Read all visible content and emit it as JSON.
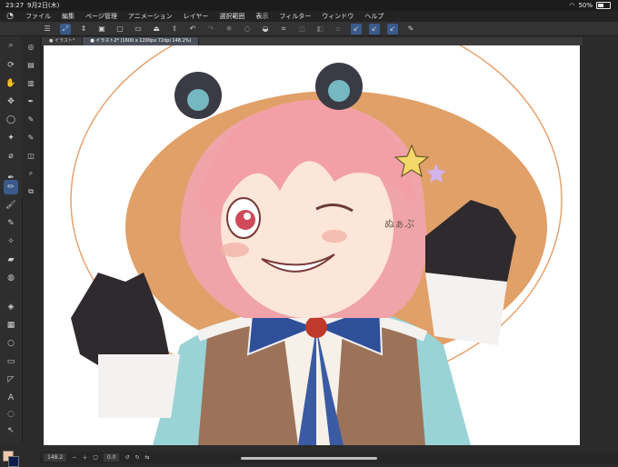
{
  "status": {
    "time": "23:27",
    "date": "9月2日(木)",
    "battery_text": "50%",
    "battery_level": 0.5
  },
  "menu": [
    "ファイル",
    "編集",
    "ページ管理",
    "アニメーション",
    "レイヤー",
    "選択範囲",
    "表示",
    "フィルター",
    "ウィンドウ",
    "ヘルプ"
  ],
  "tabs": [
    {
      "label": "● イラスト*"
    },
    {
      "label": "● イラスト2* (1600 x 1200px 72dpi 148.2%)"
    }
  ],
  "artwork": {
    "signature": "ぬぁぷ"
  },
  "bottom": {
    "zoom": "148.2",
    "angle": "0.0"
  },
  "colors": {
    "foreground": "#f3c7a5",
    "background": "#0e1b4c",
    "accent": "#3a5a8c"
  }
}
